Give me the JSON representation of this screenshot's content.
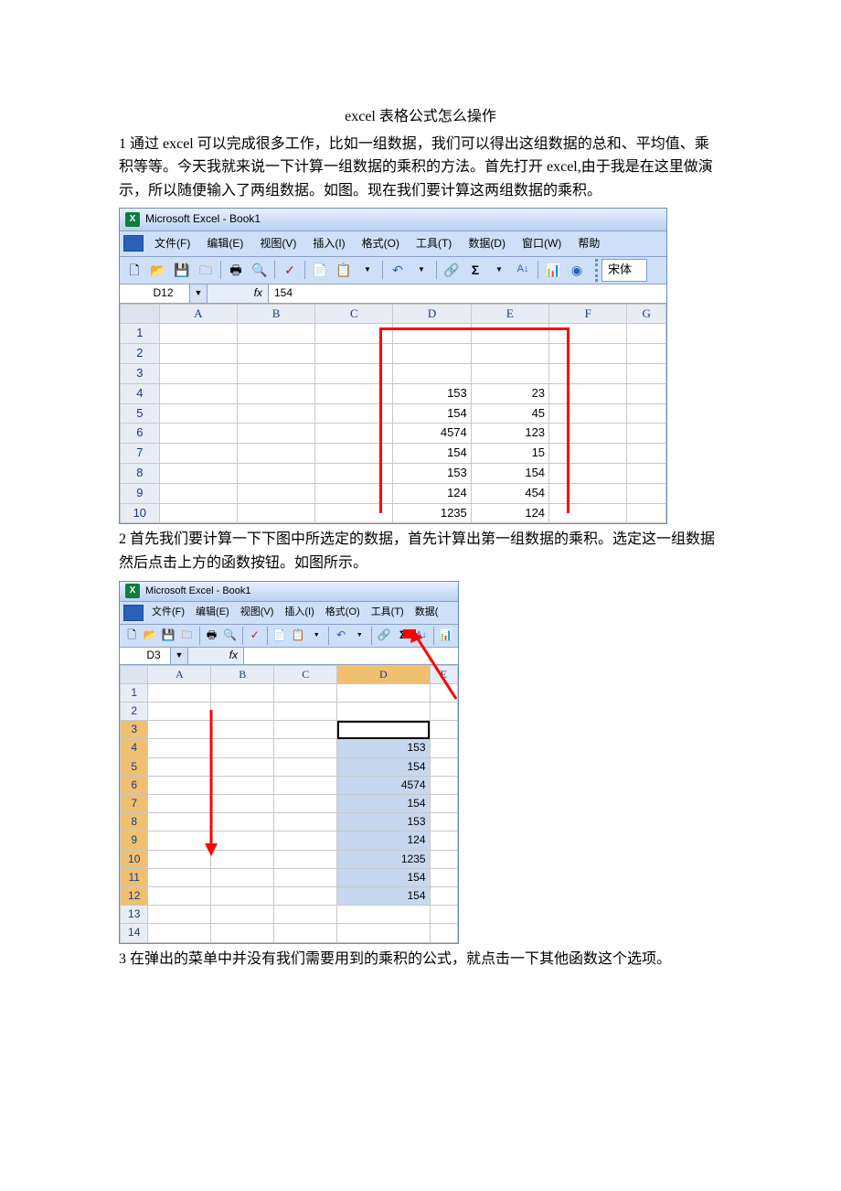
{
  "doc": {
    "title": "excel 表格公式怎么操作",
    "para1": "1 通过 excel 可以完成很多工作，比如一组数据，我们可以得出这组数据的总和、平均值、乘积等等。今天我就来说一下计算一组数据的乘积的方法。首先打开 excel,由于我是在这里做演示，所以随便输入了两组数据。如图。现在我们要计算这两组数据的乘积。",
    "para2": "2 首先我们要计算一下下图中所选定的数据，首先计算出第一组数据的乘积。选定这一组数据然后点击上方的函数按钮。如图所示。",
    "para3": "3 在弹出的菜单中并没有我们需要用到的乘积的公式，就点击一下其他函数这个选项。"
  },
  "shot1": {
    "app_title": "Microsoft Excel - Book1",
    "menus": [
      "文件(F)",
      "编辑(E)",
      "视图(V)",
      "插入(I)",
      "格式(O)",
      "工具(T)",
      "数据(D)",
      "窗口(W)",
      "帮助"
    ],
    "font_name": "宋体",
    "namebox": "D12",
    "fx_label": "fx",
    "formula_value": "154",
    "toolbar_icons": [
      "new",
      "open",
      "save",
      "perm",
      "print",
      "preview",
      "spell",
      "copy",
      "paste",
      "paste-dd",
      "undo",
      "undo-dd",
      "autosum",
      "sigma",
      "sigma-dd",
      "sort",
      "chart",
      "help"
    ],
    "cols": [
      "",
      "A",
      "B",
      "C",
      "D",
      "E",
      "F",
      "G"
    ],
    "rows": [
      {
        "n": "1",
        "D": "",
        "E": ""
      },
      {
        "n": "2",
        "D": "",
        "E": ""
      },
      {
        "n": "3",
        "D": "",
        "E": ""
      },
      {
        "n": "4",
        "D": "153",
        "E": "23"
      },
      {
        "n": "5",
        "D": "154",
        "E": "45"
      },
      {
        "n": "6",
        "D": "4574",
        "E": "123"
      },
      {
        "n": "7",
        "D": "154",
        "E": "15"
      },
      {
        "n": "8",
        "D": "153",
        "E": "154"
      },
      {
        "n": "9",
        "D": "124",
        "E": "454"
      },
      {
        "n": "10",
        "D": "1235",
        "E": "124"
      }
    ]
  },
  "shot2": {
    "app_title": "Microsoft Excel - Book1",
    "menus": [
      "文件(F)",
      "编辑(E)",
      "视图(V)",
      "插入(I)",
      "格式(O)",
      "工具(T)",
      "数据("
    ],
    "namebox": "D3",
    "fx_label": "fx",
    "formula_value": "",
    "toolbar_icons": [
      "new",
      "open",
      "save",
      "perm",
      "print",
      "preview",
      "spell",
      "copy",
      "paste",
      "paste-dd",
      "undo",
      "undo-dd",
      "autosum",
      "sigma",
      "sort",
      "chart"
    ],
    "cols": [
      "",
      "A",
      "B",
      "C",
      "D",
      "E"
    ],
    "rows": [
      {
        "n": "1",
        "D": ""
      },
      {
        "n": "2",
        "D": ""
      },
      {
        "n": "3",
        "D": "",
        "active": true
      },
      {
        "n": "4",
        "D": "153",
        "sel": true
      },
      {
        "n": "5",
        "D": "154",
        "sel": true
      },
      {
        "n": "6",
        "D": "4574",
        "sel": true
      },
      {
        "n": "7",
        "D": "154",
        "sel": true
      },
      {
        "n": "8",
        "D": "153",
        "sel": true
      },
      {
        "n": "9",
        "D": "124",
        "sel": true
      },
      {
        "n": "10",
        "D": "1235",
        "sel": true
      },
      {
        "n": "11",
        "D": "154",
        "sel": true
      },
      {
        "n": "12",
        "D": "154",
        "sel": true
      },
      {
        "n": "13",
        "D": ""
      },
      {
        "n": "14",
        "D": ""
      }
    ]
  }
}
